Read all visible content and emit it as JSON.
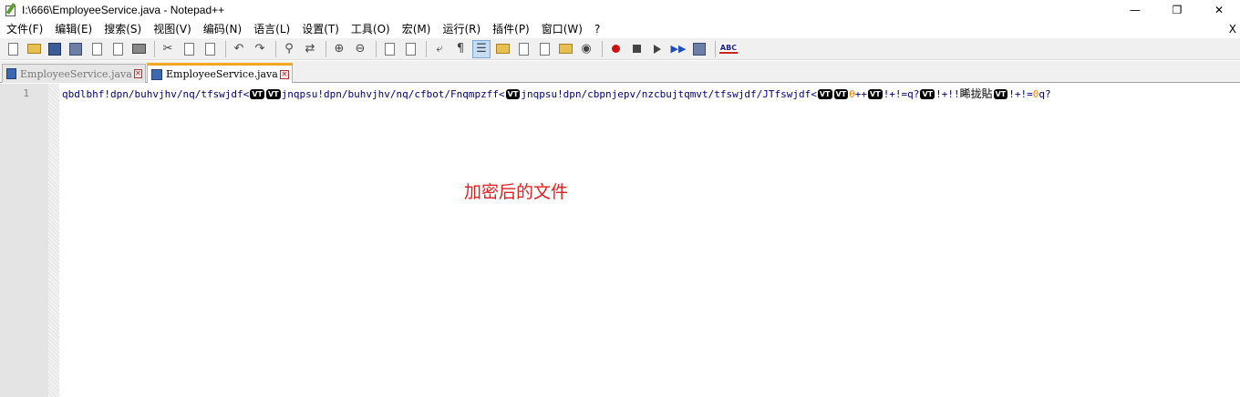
{
  "window": {
    "title": "I:\\666\\EmployeeService.java - Notepad++",
    "controls": [
      "—",
      "❐",
      "✕"
    ]
  },
  "menu": {
    "items": [
      "文件(F)",
      "编辑(E)",
      "搜索(S)",
      "视图(V)",
      "编码(N)",
      "语言(L)",
      "设置(T)",
      "工具(O)",
      "宏(M)",
      "运行(R)",
      "插件(P)",
      "窗口(W)",
      "?"
    ],
    "close": "X"
  },
  "toolbar": {
    "icons": [
      "new-file-icon",
      "open-file-icon",
      "save-icon",
      "save-all-icon",
      "close-icon",
      "close-all-icon",
      "print-icon",
      "cut-icon",
      "copy-icon",
      "paste-icon",
      "undo-icon",
      "redo-icon",
      "find-icon",
      "replace-icon",
      "zoom-in-icon",
      "zoom-out-icon",
      "sync-vertical-icon",
      "sync-horizontal-icon",
      "word-wrap-icon",
      "show-all-chars-icon",
      "indent-guide-icon",
      "doc-map-icon",
      "function-list-icon",
      "folder-workspace-icon",
      "monitoring-icon",
      "record-macro-icon",
      "stop-record-icon",
      "playback-macro-icon",
      "run-macro-multiple-icon",
      "save-macro-icon",
      "spell-check-icon"
    ],
    "active_icon": "indent-guide-icon",
    "spell_label": "ABC"
  },
  "tabs": [
    {
      "label": "EmployeeService.java",
      "active": false
    },
    {
      "label": "EmployeeService.java",
      "active": true
    }
  ],
  "editor": {
    "line_number": "1",
    "segments": [
      {
        "type": "text",
        "value": "qbdlbhf!dpn/buhvjhv/nq/tfswjdf<"
      },
      {
        "type": "ctrl",
        "value": "VT"
      },
      {
        "type": "ctrl",
        "value": "VT"
      },
      {
        "type": "text",
        "value": "jnqpsu!dpn/buhvjhv/nq/cfbot/Fnqmpzff<"
      },
      {
        "type": "ctrl",
        "value": "VT"
      },
      {
        "type": "text",
        "value": "jnqpsu!dpn/cbpnjepv/nzcbujtqmvt/tfswjdf/JTfswjdf<"
      },
      {
        "type": "ctrl",
        "value": "VT"
      },
      {
        "type": "ctrl",
        "value": "VT"
      },
      {
        "type": "num",
        "value": "0"
      },
      {
        "type": "text",
        "value": "++"
      },
      {
        "type": "ctrl",
        "value": "VT"
      },
      {
        "type": "text",
        "value": "!+!=q?"
      },
      {
        "type": "ctrl",
        "value": "VT"
      },
      {
        "type": "text",
        "value": "!+!!"
      },
      {
        "type": "cjk",
        "value": "睎拢貼"
      },
      {
        "type": "ctrl",
        "value": "VT"
      },
      {
        "type": "text",
        "value": "!+!="
      },
      {
        "type": "num",
        "value": "0"
      },
      {
        "type": "text",
        "value": "q?"
      }
    ]
  },
  "annotation": {
    "text": "加密后的文件",
    "color": "#e02020"
  },
  "colors": {
    "code": "#000080",
    "number": "#ff8000",
    "tab_accent": "#f5a623"
  }
}
